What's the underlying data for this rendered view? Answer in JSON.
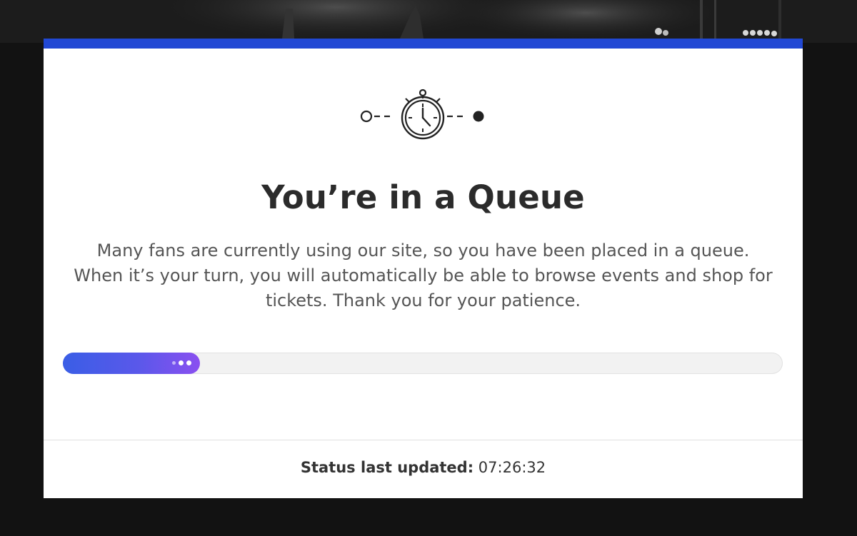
{
  "queue": {
    "title": "You’re in a Queue",
    "message": "Many fans are currently using our site, so you have been placed in a queue. When it’s your turn, you will automatically be able to browse events and shop for tickets. Thank you for your patience.",
    "graphic_icon": "stopwatch-icon",
    "progress_fraction": 0.19
  },
  "status": {
    "label": "Status last updated:",
    "time": "07:26:32"
  },
  "colors": {
    "accent_bar": "#2148d4",
    "progress_start": "#3a5ee6",
    "progress_end": "#8a50f0",
    "background": "#121212"
  }
}
